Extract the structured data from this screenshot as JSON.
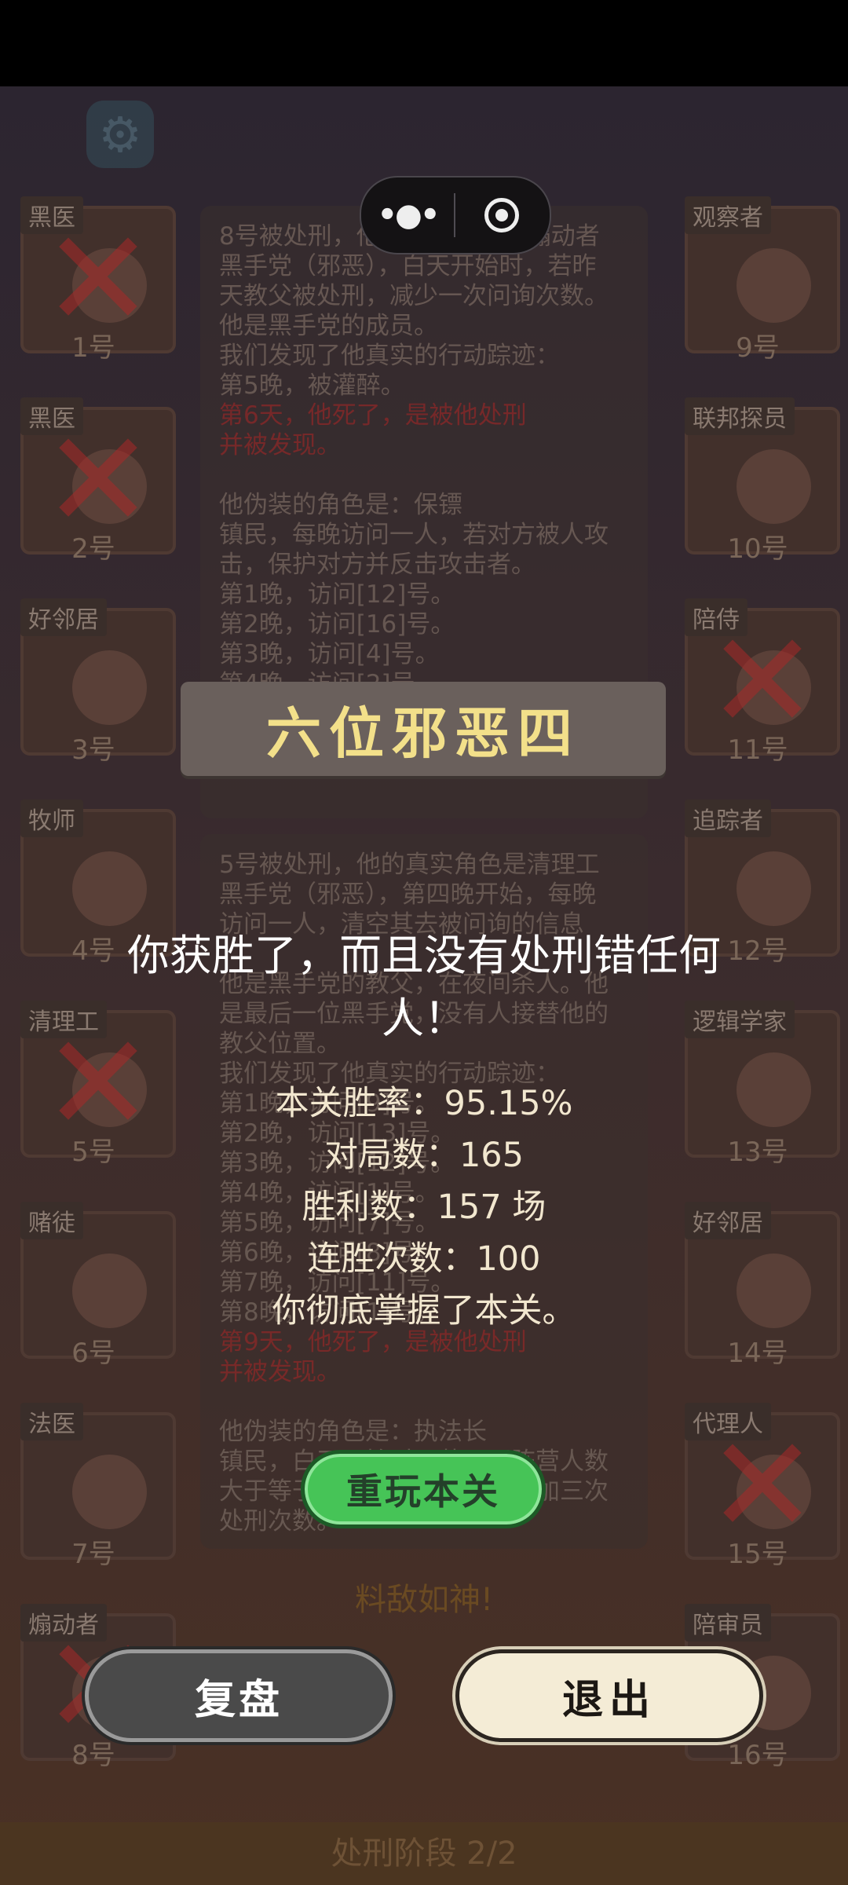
{
  "overlay": {
    "title": "六位邪恶四",
    "result_line1": "你获胜了，而且没有处刑错任何",
    "result_line2": "人！",
    "win_rate": "本关胜率：95.15%",
    "games": "对局数：165",
    "wins": "胜利数：157 场",
    "streak": "连胜次数：100",
    "mastery": "你彻底掌握了本关。",
    "replay_button": "重玩本关",
    "review_button": "复盘",
    "exit_button": "退出"
  },
  "background": {
    "faint_text": "料敌如神!",
    "phase": "处刑阶段 2/2",
    "players_left": [
      {
        "role": "黑医",
        "num": "1号",
        "dead": true
      },
      {
        "role": "黑医",
        "num": "2号",
        "dead": true
      },
      {
        "role": "好邻居",
        "num": "3号",
        "dead": false
      },
      {
        "role": "牧师",
        "num": "4号",
        "dead": false
      },
      {
        "role": "清理工",
        "num": "5号",
        "dead": true
      },
      {
        "role": "赌徒",
        "num": "6号",
        "dead": false
      },
      {
        "role": "法医",
        "num": "7号",
        "dead": false
      },
      {
        "role": "煽动者",
        "num": "8号",
        "dead": true
      }
    ],
    "players_right": [
      {
        "role": "观察者",
        "num": "9号",
        "dead": false
      },
      {
        "role": "联邦探员",
        "num": "10号",
        "dead": false
      },
      {
        "role": "陪侍",
        "num": "11号",
        "dead": true
      },
      {
        "role": "追踪者",
        "num": "12号",
        "dead": false
      },
      {
        "role": "逻辑学家",
        "num": "13号",
        "dead": false
      },
      {
        "role": "好邻居",
        "num": "14号",
        "dead": false
      },
      {
        "role": "代理人",
        "num": "15号",
        "dead": true
      },
      {
        "role": "陪审员",
        "num": "16号",
        "dead": false
      }
    ],
    "log1": [
      "8号被处刑，他的真实角色是煽动者",
      "黑手党（邪恶），白天开始时，若昨",
      "天教父被处刑，减少一次问询次数。",
      "他是黑手党的成员。",
      "我们发现了他真实的行动踪迹：",
      "第5晚，被灌醉。",
      "第6天，他死了，是被他处刑",
      "并被发现。",
      "",
      "他伪装的角色是：保镖",
      "镇民，每晚访问一人，若对方被人攻",
      "击，保护对方并反击攻击者。",
      "第1晚，访问[12]号。",
      "第2晚，访问[16]号。",
      "第3晚，访问[4]号。",
      "第4晚，访问[2]号。"
    ],
    "log2": [
      "5号被处刑，他的真实角色是清理工",
      "黑手党（邪恶），第四晚开始，每晚",
      "访问一人，清空其去被问询的信息",
      "",
      "他是黑手党的教父，在夜间杀人。他",
      "是最后一位黑手党，没有人接替他的",
      "教父位置。",
      "我们发现了他真实的行动踪迹：",
      "第1晚，访问[9]号。",
      "第2晚，访问[13]号。",
      "第3晚，访问[12]号。",
      "第4晚，访问[1]号。",
      "第5晚，访问[7]号。",
      "第6晚，访问[8]号。",
      "第7晚，访问[11]号。",
      "第8晚，访问[1]号。",
      "第9天，他死了，是被他处刑",
      "并被发现。",
      "",
      "他伪装的角色是：执法长",
      "镇民，白天开始时，若邪恶阵营人数",
      "大于等于善良阵营人数，则增加三次",
      "处刑次数。"
    ]
  }
}
